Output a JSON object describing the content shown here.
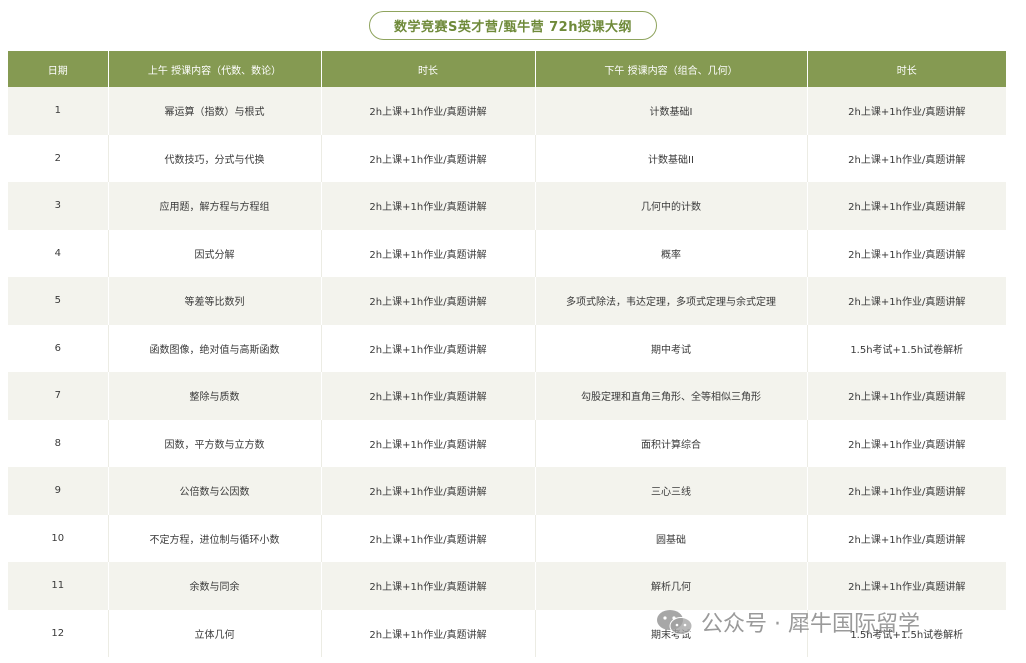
{
  "title": "数学竞赛S英才营/甄牛营 72h授课大纲",
  "headers": [
    "日期",
    "上午 授课内容（代数、数论）",
    "时长",
    "下午 授课内容（组合、几何）",
    "时长"
  ],
  "rows": [
    {
      "day": "1",
      "am": "幂运算（指数）与根式",
      "am_time": "2h上课+1h作业/真题讲解",
      "pm": "计数基础I",
      "pm_time": "2h上课+1h作业/真题讲解"
    },
    {
      "day": "2",
      "am": "代数技巧，分式与代换",
      "am_time": "2h上课+1h作业/真题讲解",
      "pm": "计数基础II",
      "pm_time": "2h上课+1h作业/真题讲解"
    },
    {
      "day": "3",
      "am": "应用题，解方程与方程组",
      "am_time": "2h上课+1h作业/真题讲解",
      "pm": "几何中的计数",
      "pm_time": "2h上课+1h作业/真题讲解"
    },
    {
      "day": "4",
      "am": "因式分解",
      "am_time": "2h上课+1h作业/真题讲解",
      "pm": "概率",
      "pm_time": "2h上课+1h作业/真题讲解"
    },
    {
      "day": "5",
      "am": "等差等比数列",
      "am_time": "2h上课+1h作业/真题讲解",
      "pm": "多项式除法，韦达定理，多项式定理与余式定理",
      "pm_time": "2h上课+1h作业/真题讲解"
    },
    {
      "day": "6",
      "am": "函数图像，绝对值与高斯函数",
      "am_time": "2h上课+1h作业/真题讲解",
      "pm": "期中考试",
      "pm_time": "1.5h考试+1.5h试卷解析"
    },
    {
      "day": "7",
      "am": "整除与质数",
      "am_time": "2h上课+1h作业/真题讲解",
      "pm": "勾股定理和直角三角形、全等相似三角形",
      "pm_time": "2h上课+1h作业/真题讲解"
    },
    {
      "day": "8",
      "am": "因数，平方数与立方数",
      "am_time": "2h上课+1h作业/真题讲解",
      "pm": "面积计算综合",
      "pm_time": "2h上课+1h作业/真题讲解"
    },
    {
      "day": "9",
      "am": "公倍数与公因数",
      "am_time": "2h上课+1h作业/真题讲解",
      "pm": "三心三线",
      "pm_time": "2h上课+1h作业/真题讲解"
    },
    {
      "day": "10",
      "am": "不定方程，进位制与循环小数",
      "am_time": "2h上课+1h作业/真题讲解",
      "pm": "圆基础",
      "pm_time": "2h上课+1h作业/真题讲解"
    },
    {
      "day": "11",
      "am": "余数与同余",
      "am_time": "2h上课+1h作业/真题讲解",
      "pm": "解析几何",
      "pm_time": "2h上课+1h作业/真题讲解"
    },
    {
      "day": "12",
      "am": "立体几何",
      "am_time": "2h上课+1h作业/真题讲解",
      "pm": "期末考试",
      "pm_time": "1.5h考试+1.5h试卷解析"
    }
  ],
  "watermark": {
    "text": "公众号 · 犀牛国际留学",
    "icon": "wechat-icon"
  },
  "colors": {
    "header_bg": "#859a52",
    "title_text": "#6f8a3a",
    "row_shade": "#f3f3ed"
  }
}
